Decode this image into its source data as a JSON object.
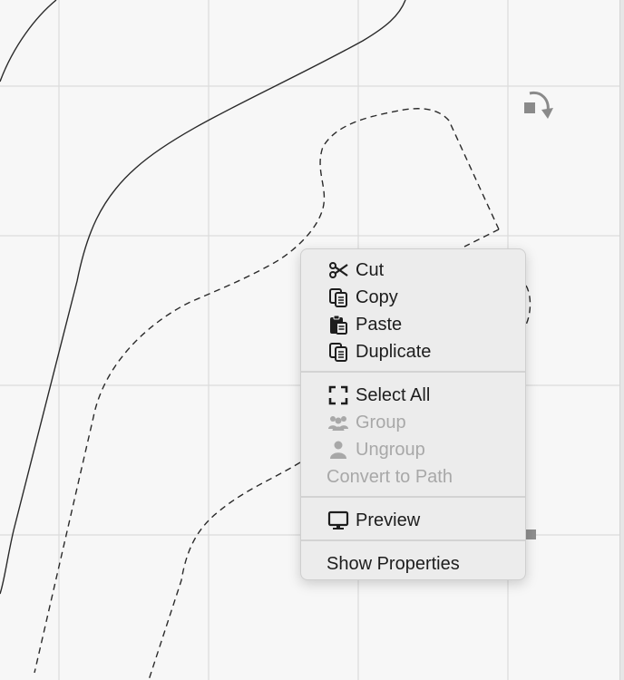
{
  "context_menu": {
    "items": [
      {
        "label": "Cut",
        "icon": "scissors-icon",
        "enabled": true
      },
      {
        "label": "Copy",
        "icon": "copy-icon",
        "enabled": true
      },
      {
        "label": "Paste",
        "icon": "paste-icon",
        "enabled": true
      },
      {
        "label": "Duplicate",
        "icon": "duplicate-icon",
        "enabled": true
      },
      {
        "label": "Select All",
        "icon": "select-all-icon",
        "enabled": true
      },
      {
        "label": "Group",
        "icon": "group-icon",
        "enabled": false
      },
      {
        "label": "Ungroup",
        "icon": "ungroup-icon",
        "enabled": false
      },
      {
        "label": "Convert to Path",
        "icon": "",
        "enabled": false
      },
      {
        "label": "Preview",
        "icon": "monitor-icon",
        "enabled": true
      },
      {
        "label": "Show Properties",
        "icon": "",
        "enabled": true
      }
    ]
  },
  "colors": {
    "canvas_bg": "#f7f7f7",
    "grid": "#dcdcdc",
    "menu_bg": "#ececec",
    "text": "#1d1d1d",
    "disabled_text": "#a8a8a8"
  }
}
